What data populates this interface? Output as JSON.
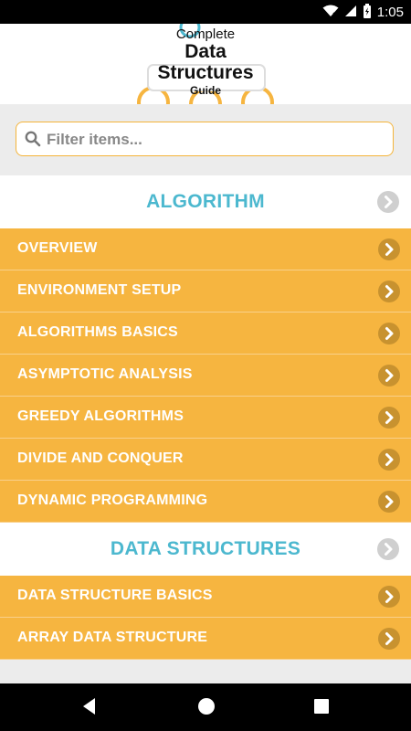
{
  "status_bar": {
    "time": "1:05"
  },
  "logo": {
    "line1": "Complete",
    "line2": "Data",
    "line3": "Structures",
    "line4": "Guide"
  },
  "search": {
    "placeholder": "Filter items..."
  },
  "sections": [
    {
      "title": "ALGORITHM",
      "items": [
        {
          "label": "OVERVIEW"
        },
        {
          "label": "ENVIRONMENT SETUP"
        },
        {
          "label": "ALGORITHMS BASICS"
        },
        {
          "label": "ASYMPTOTIC ANALYSIS"
        },
        {
          "label": "GREEDY ALGORITHMS"
        },
        {
          "label": "DIVIDE AND CONQUER"
        },
        {
          "label": "DYNAMIC PROGRAMMING"
        }
      ]
    },
    {
      "title": "DATA STRUCTURES",
      "items": [
        {
          "label": "DATA STRUCTURE BASICS"
        },
        {
          "label": "ARRAY DATA STRUCTURE"
        }
      ]
    }
  ],
  "colors": {
    "accent_orange": "#f6b540",
    "section_title": "#4cb8cf",
    "chevron_gray": "#cfcfcf"
  }
}
